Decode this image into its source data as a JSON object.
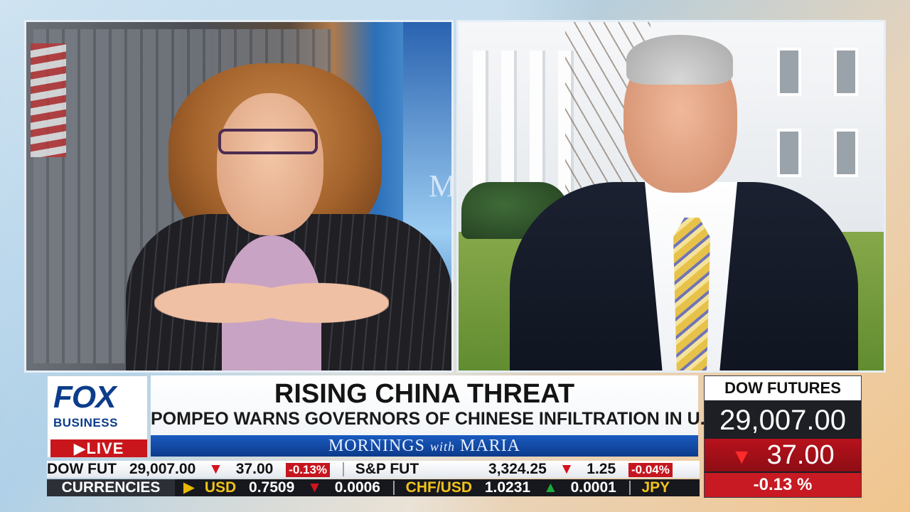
{
  "show_logo_bg": "M",
  "lower_third": {
    "network_logo": {
      "line1": "FOX",
      "line2": "BUSINESS"
    },
    "live_label": "▶LIVE",
    "headline": "RISING CHINA THREAT",
    "subheadline": "POMPEO WARNS GOVERNORS OF CHINESE INFILTRATION IN U.S.",
    "show_name": "MORNINGS",
    "show_name_with": "with",
    "show_name_host": "MARIA"
  },
  "dow_futures": {
    "title": "DOW FUTURES",
    "value": "29,007.00",
    "change_arrow": "▼",
    "change": "37.00",
    "pct": "-0.13 %",
    "accent": "#c71a22"
  },
  "ticker_1": {
    "dow_label": "DOW FUT",
    "dow_value": "29,007.00",
    "dow_arrow": "▼",
    "dow_change": "37.00",
    "dow_pct": "-0.13%",
    "sp_label": "S&P FUT",
    "sp_value": "3,324.25",
    "sp_arrow": "▼",
    "sp_change": "1.25",
    "sp_pct": "-0.04%"
  },
  "ticker_2": {
    "label": "CURRENCIES",
    "arrow": "▶",
    "usd_label": "USD",
    "usd_value": "0.7509",
    "usd_arrow": "▼",
    "usd_change": "0.0006",
    "chf_label": "CHF/USD",
    "chf_value": "1.0231",
    "chf_arrow": "▲",
    "chf_change": "0.0001",
    "jpy_label": "JPY"
  }
}
